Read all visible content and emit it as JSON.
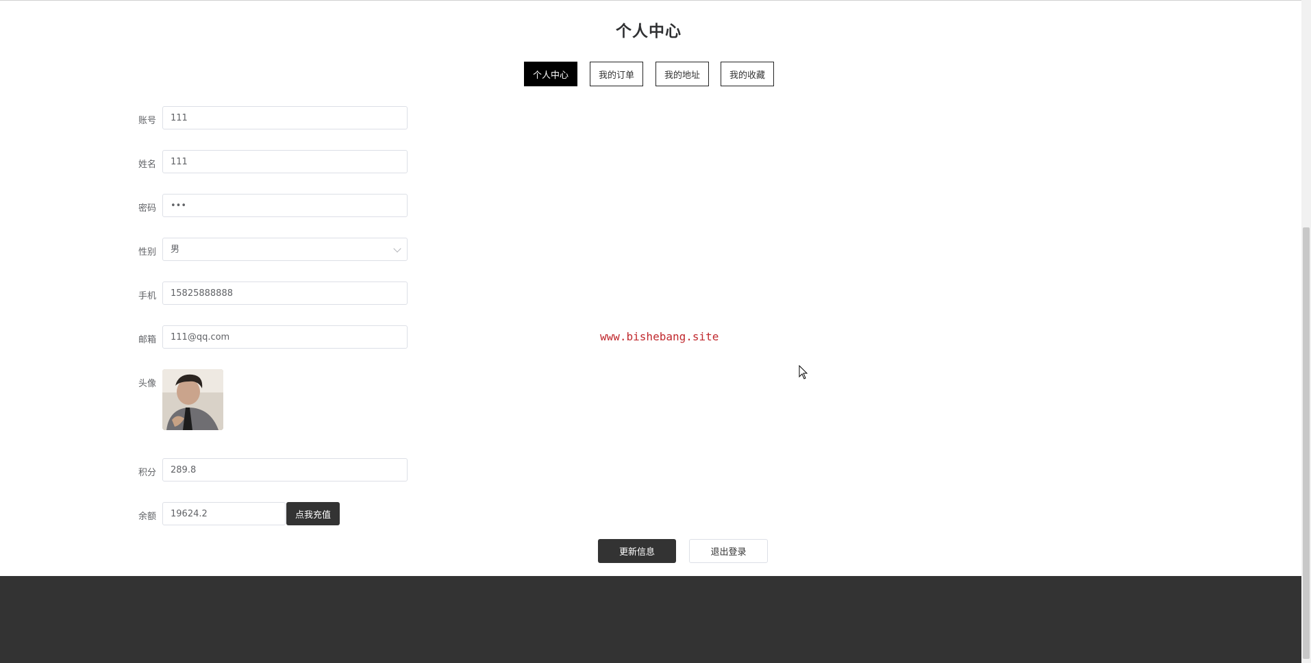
{
  "page": {
    "title": "个人中心"
  },
  "tabs": [
    {
      "label": "个人中心",
      "active": true
    },
    {
      "label": "我的订单",
      "active": false
    },
    {
      "label": "我的地址",
      "active": false
    },
    {
      "label": "我的收藏",
      "active": false
    }
  ],
  "form": {
    "account": {
      "label": "账号",
      "value": "111"
    },
    "name": {
      "label": "姓名",
      "value": "111"
    },
    "password": {
      "label": "密码",
      "value": "•••"
    },
    "gender": {
      "label": "性别",
      "value": "男"
    },
    "phone": {
      "label": "手机",
      "value": "15825888888"
    },
    "email": {
      "label": "邮箱",
      "value": "111@qq.com"
    },
    "avatar": {
      "label": "头像"
    },
    "points": {
      "label": "积分",
      "value": "289.8"
    },
    "balance": {
      "label": "余额",
      "value": "19624.2",
      "recharge_label": "点我充值"
    }
  },
  "actions": {
    "update_label": "更新信息",
    "logout_label": "退出登录"
  },
  "watermark": "www.bishebang.site",
  "colors": {
    "primary_dark": "#333333",
    "active_tab": "#000000",
    "watermark": "#c0282d"
  }
}
